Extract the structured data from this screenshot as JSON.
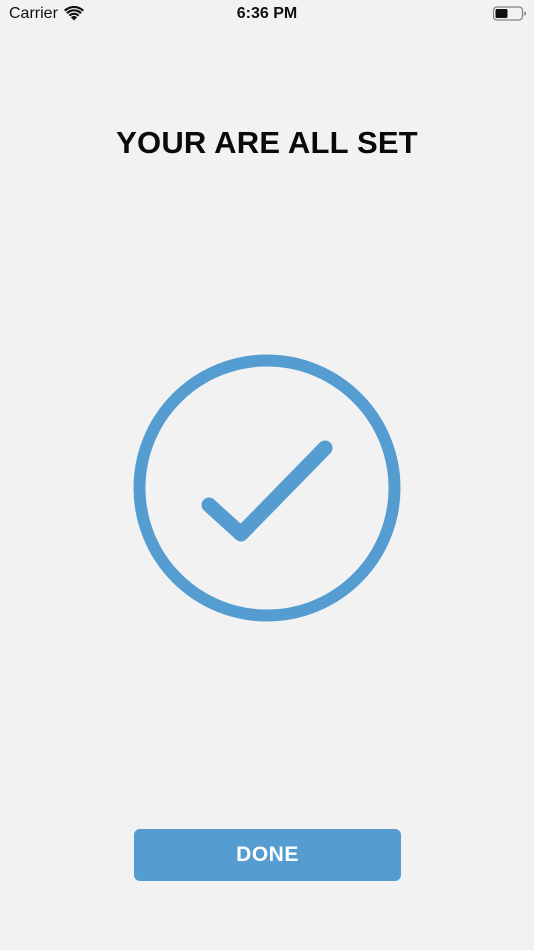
{
  "status_bar": {
    "carrier": "Carrier",
    "time": "6:36 PM",
    "wifi_icon": "wifi-icon",
    "battery_icon": "battery-icon"
  },
  "main": {
    "title": "YOUR ARE ALL SET",
    "graphic_icon": "check-circle-icon",
    "accent_color": "#559dd0"
  },
  "footer": {
    "done_label": "DONE"
  }
}
